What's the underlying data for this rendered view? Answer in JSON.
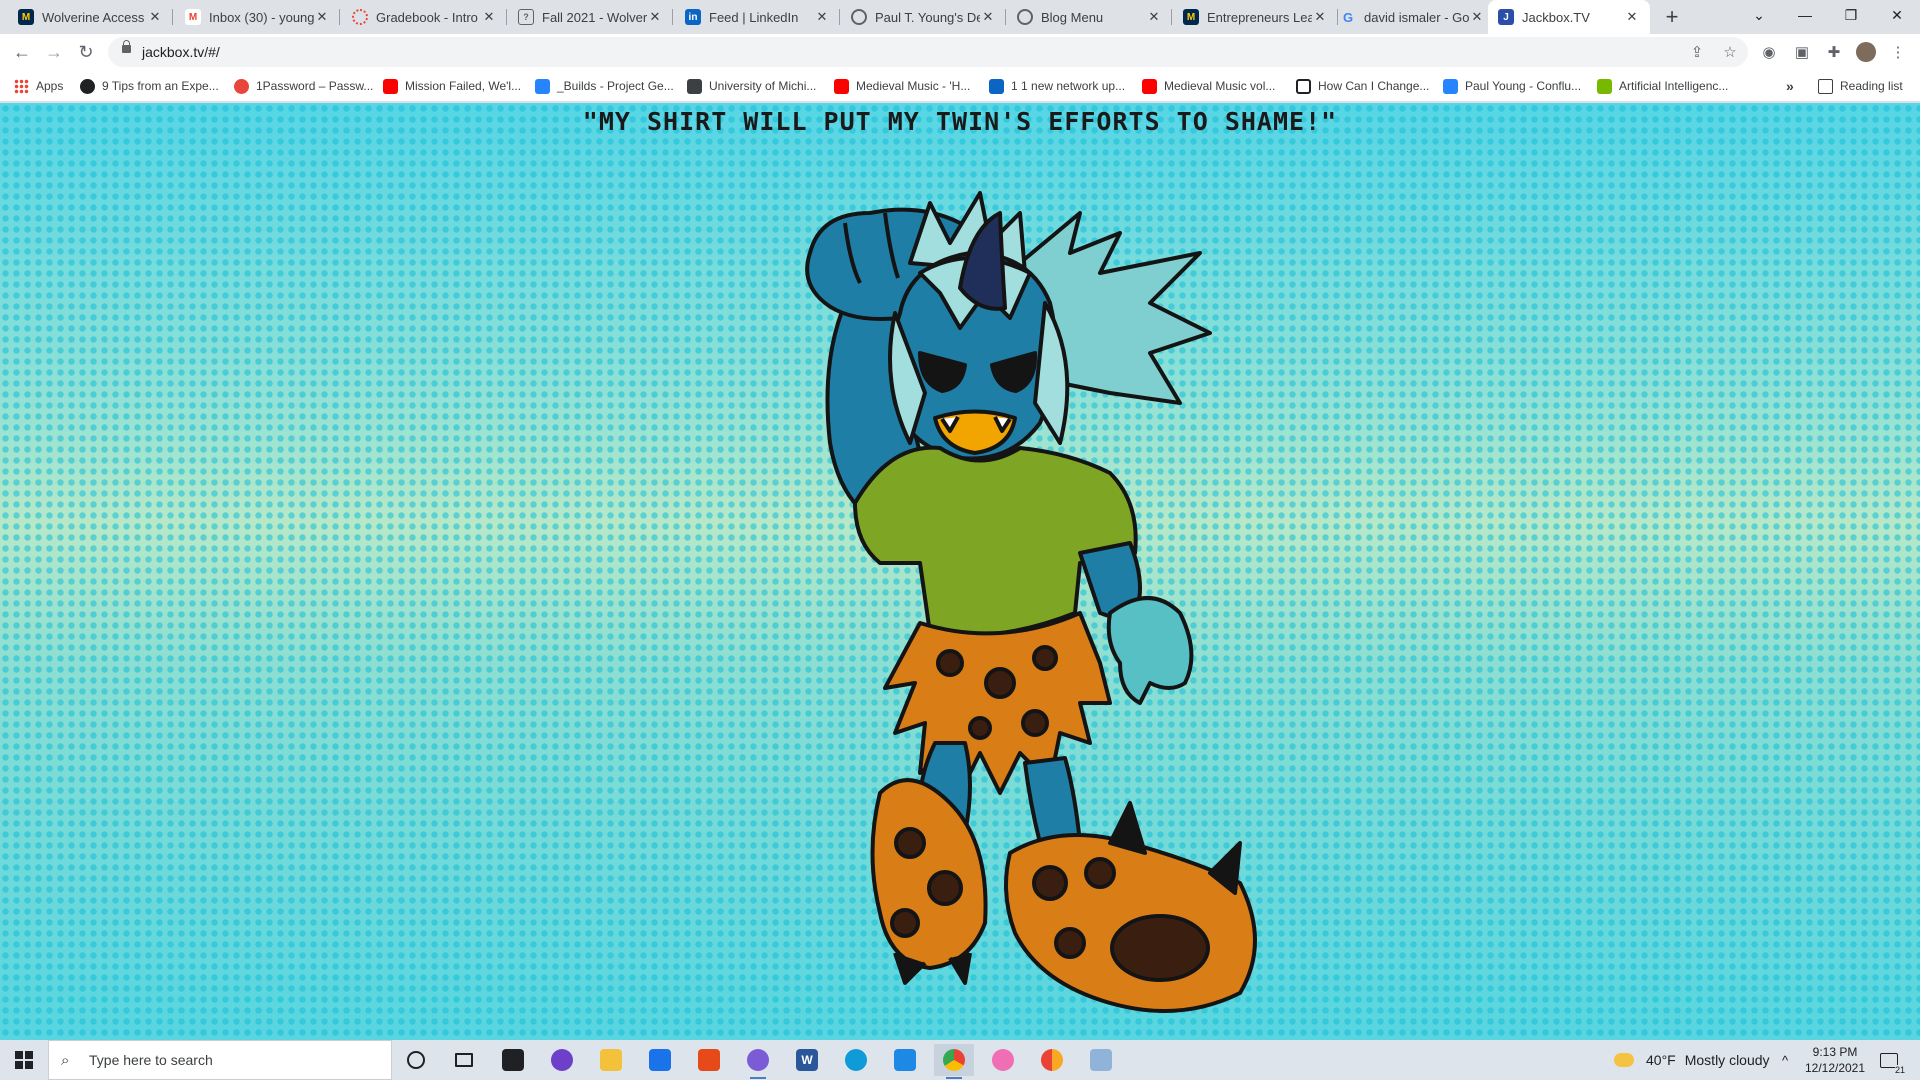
{
  "tabs": [
    {
      "title": "Wolverine Access -",
      "fav_color": "#00274c",
      "fav_glyph": "M"
    },
    {
      "title": "Inbox (30) - young",
      "fav_color": "#ea4335",
      "fav_glyph": "M"
    },
    {
      "title": "Gradebook - Intro",
      "fav_color": "#e8453c",
      "fav_glyph": "○"
    },
    {
      "title": "Fall 2021 - Wolver",
      "fav_color": "#5f6368",
      "fav_glyph": "?"
    },
    {
      "title": "Feed | LinkedIn",
      "fav_color": "#0a66c2",
      "fav_glyph": "in"
    },
    {
      "title": "Paul T. Young's De",
      "fav_color": "#5f6368",
      "fav_glyph": "◐"
    },
    {
      "title": "Blog Menu",
      "fav_color": "#5f6368",
      "fav_glyph": "◐"
    },
    {
      "title": "Entrepreneurs Lea",
      "fav_color": "#00274c",
      "fav_glyph": "M"
    },
    {
      "title": "david ismaler - Go",
      "fav_color": "#4285f4",
      "fav_glyph": "G"
    },
    {
      "title": "Jackbox.TV",
      "fav_color": "#2b4fa8",
      "fav_glyph": "J"
    }
  ],
  "address": "jackbox.tv/#/",
  "bookmarks": [
    {
      "label": "Apps",
      "color": "#ea4335"
    },
    {
      "label": "9 Tips from an Expe...",
      "color": "#202124"
    },
    {
      "label": "1Password – Passw...",
      "color": "#e8453c"
    },
    {
      "label": "Mission Failed, We'l...",
      "color": "#ff0000"
    },
    {
      "label": "_Builds - Project Ge...",
      "color": "#2684ff"
    },
    {
      "label": "University of Michi...",
      "color": "#3c4043"
    },
    {
      "label": "Medieval Music - 'H...",
      "color": "#ff0000"
    },
    {
      "label": "1 1 new network up...",
      "color": "#0a66c2"
    },
    {
      "label": "Medieval Music vol...",
      "color": "#ff0000"
    },
    {
      "label": "How Can I Change...",
      "color": "#202124"
    },
    {
      "label": "Paul Young - Conflu...",
      "color": "#2684ff"
    },
    {
      "label": "Artificial Intelligenc...",
      "color": "#76b900"
    }
  ],
  "reading_list": "Reading list",
  "page": {
    "quote": "\"My shirt will put my twin's efforts to shame!\""
  },
  "taskbar": {
    "search_placeholder": "Type here to search",
    "weather_temp": "40°F",
    "weather_desc": "Mostly cloudy",
    "time": "9:13 PM",
    "date": "12/12/2021",
    "notification_count": "21"
  }
}
